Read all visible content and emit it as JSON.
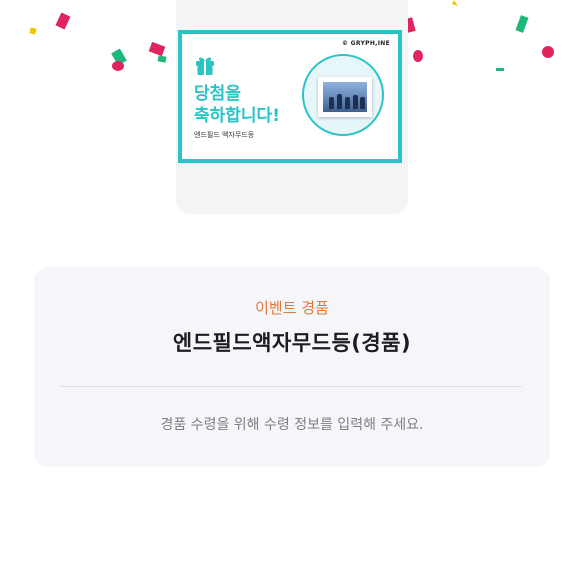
{
  "colors": {
    "accent_teal": "#2bc4c6",
    "label_orange": "#e0793a",
    "panel_bg": "#f5f6f9",
    "confetti_red": "#e0245e",
    "confetti_green": "#1db87a",
    "confetti_yellow": "#f5c400"
  },
  "win_card": {
    "brand": "© GRYPH,INE",
    "headline": "당첨을\n축하합니다!",
    "prize_small": "엔드필드 액자무드등",
    "gift_icon": "gift-icon"
  },
  "event": {
    "label": "이벤트 경품",
    "prize_title": "엔드필드액자무드등(경품)",
    "notice": "경품 수령을 위해 수령 정보를 입력해 주세요."
  }
}
